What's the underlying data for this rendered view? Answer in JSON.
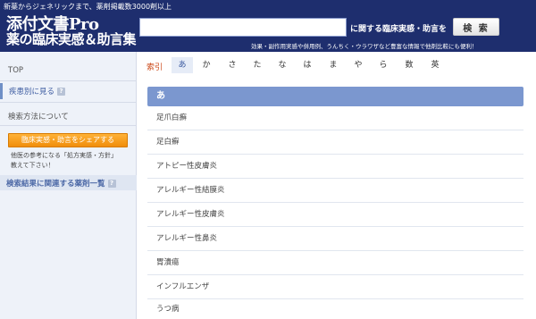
{
  "header": {
    "tagline": "新薬からジェネリックまで、薬剤掲載数3000剤以上",
    "logo_line1": "添付文書Pro",
    "logo_line2": "薬の臨床実感＆助言集",
    "search_placeholder": "",
    "search_suffix": "に関する臨床実感・助言を",
    "search_button": "検 索",
    "subtext": "効果・副作用実感や併用例、うんちく・ウラワザなど豊富な情報で他剤比較にも便利！",
    "colors": {
      "background": "#1e2e6e"
    }
  },
  "sidebar": {
    "top_link": "TOP",
    "disease_link": "疾患別に見る",
    "method_link": "検索方法について",
    "share_button": "臨床実感・助言をシェアする",
    "share_note_1": "他医の参考になる「処方実感・方針」",
    "share_note_2": "教えて下さい！",
    "related_heading": "検索結果に関連する薬剤一覧",
    "help_icon_glyph": "?"
  },
  "main": {
    "index_label": "索引",
    "kana_tabs": [
      "あ",
      "か",
      "さ",
      "た",
      "な",
      "は",
      "ま",
      "や",
      "ら",
      "数",
      "英"
    ],
    "active_tab": "あ",
    "section_heading": "あ",
    "items": [
      "足爪白癬",
      "足白癬",
      "アトピー性皮膚炎",
      "アレルギー性結膜炎",
      "アレルギー性皮膚炎",
      "アレルギー性鼻炎",
      "胃潰瘍",
      "インフルエンザ",
      "うつ病"
    ]
  }
}
